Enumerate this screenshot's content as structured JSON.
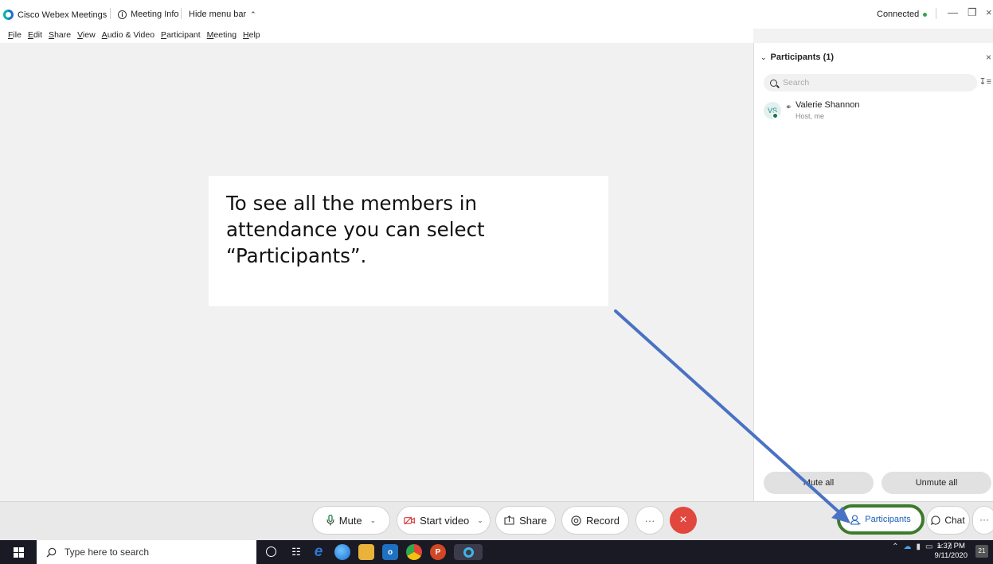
{
  "titlebar": {
    "app_name": "Cisco Webex Meetings",
    "meeting_info_label": "Meeting Info",
    "hide_menu_label": "Hide menu bar",
    "status": "Connected"
  },
  "menu": {
    "items": [
      {
        "ul": "F",
        "rest": "ile"
      },
      {
        "ul": "E",
        "rest": "dit"
      },
      {
        "ul": "S",
        "rest": "hare"
      },
      {
        "ul": "V",
        "rest": "iew"
      },
      {
        "ul": "A",
        "rest": "udio & Video"
      },
      {
        "ul": "P",
        "rest": "articipant"
      },
      {
        "ul": "M",
        "rest": "eeting"
      },
      {
        "ul": "H",
        "rest": "elp"
      }
    ]
  },
  "callout": {
    "text": "To see all the members in attendance you can select “Participants”."
  },
  "panel": {
    "title": "Participants (1)",
    "search_placeholder": "Search",
    "participant": {
      "initials": "VS",
      "name": "Valerie Shannon",
      "role": "Host, me"
    },
    "mute_all_label": "Mute all",
    "unmute_all_label": "Unmute all"
  },
  "controls": {
    "mute_label": "Mute",
    "start_video_label": "Start video",
    "share_label": "Share",
    "record_label": "Record",
    "participants_label": "Participants",
    "chat_label": "Chat"
  },
  "taskbar": {
    "search_placeholder": "Type here to search",
    "time": "1:37 PM",
    "date": "9/11/2020",
    "notification_count": "21"
  },
  "colors": {
    "accent": "#1a5fb4",
    "end_button": "#e2473d",
    "highlight_ring": "#3d7a2b",
    "arrow": "#4a72c4"
  }
}
